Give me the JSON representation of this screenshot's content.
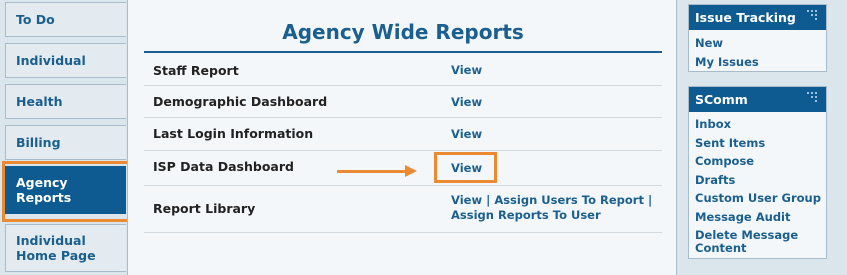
{
  "nav": {
    "tabs": [
      {
        "label": "To Do"
      },
      {
        "label": "Individual"
      },
      {
        "label": "Health"
      },
      {
        "label": "Billing"
      },
      {
        "label": "Agency Reports",
        "line1": "Agency",
        "line2": "Reports",
        "active": true
      },
      {
        "label": "Individual Home Page",
        "line1": "Individual",
        "line2": "Home Page"
      }
    ]
  },
  "main": {
    "title": "Agency Wide Reports",
    "reports": [
      {
        "name": "Staff Report",
        "link": "View"
      },
      {
        "name": "Demographic Dashboard",
        "link": "View"
      },
      {
        "name": "Last Login Information",
        "link": "View"
      },
      {
        "name": "ISP Data Dashboard",
        "link": "View"
      },
      {
        "name": "Report Library",
        "link": "View",
        "link2": "Assign Users To Report",
        "link3": "Assign Reports To User",
        "separator": "|"
      }
    ]
  },
  "issue_tracking": {
    "title": "Issue Tracking",
    "items": [
      "New",
      "My Issues"
    ]
  },
  "scomm": {
    "title": "SComm",
    "items": [
      "Inbox",
      "Sent Items",
      "Compose",
      "Drafts",
      "Custom User Group",
      "Message Audit",
      "Delete Message Content"
    ],
    "last_line1": "Delete Message",
    "last_line2": "Content"
  },
  "colors": {
    "brand_blue": "#0e5b92",
    "link_blue": "#1a5f8e",
    "highlight_orange": "#ea8a33",
    "background": "#dbe5ec"
  },
  "icons": [
    "grip-icon",
    "arrow-icon"
  ]
}
